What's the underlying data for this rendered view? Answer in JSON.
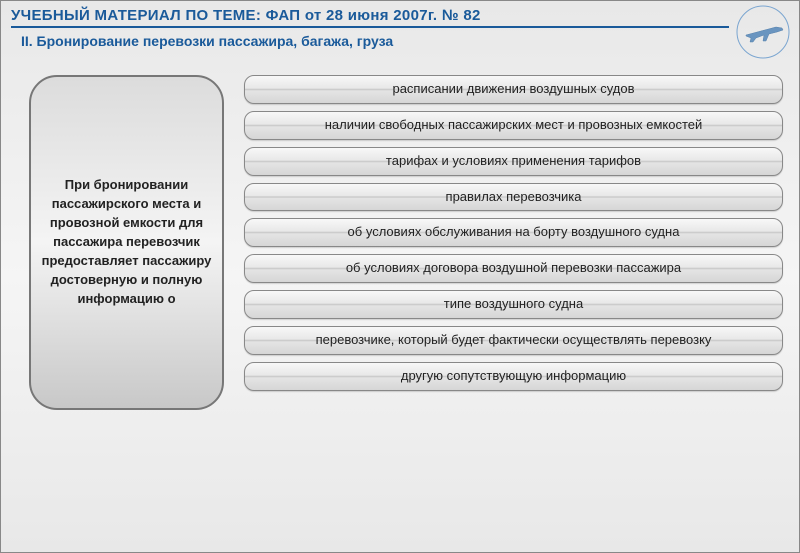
{
  "header": {
    "title": "УЧЕБНЫЙ МАТЕРИАЛ ПО ТЕМЕ: ФАП от 28 июня 2007г. № 82",
    "subtitle": "II. Бронирование перевозки пассажира, багажа, груза"
  },
  "left_panel": {
    "text": "При бронировании пассажирского места и провозной емкости для пассажира перевозчик предоставляет пассажиру достоверную и полную информацию о"
  },
  "items": [
    "расписании движения воздушных судов",
    "наличии свободных пассажирских мест и провозных емкостей",
    "тарифах и условиях применения тарифов",
    "правилах перевозчика",
    "об условиях обслуживания на борту воздушного судна",
    "об условиях договора воздушной перевозки пассажира",
    "типе воздушного судна",
    "перевозчике, который будет фактически осуществлять перевозку",
    "другую сопутствующую информацию"
  ]
}
